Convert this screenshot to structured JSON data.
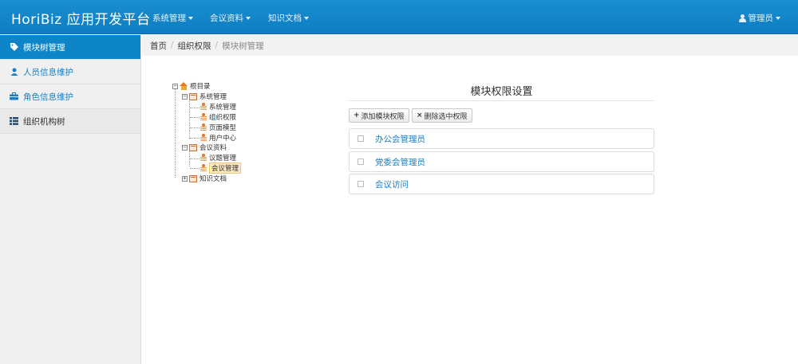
{
  "navbar": {
    "brand": "HoriBiz 应用开发平台",
    "menus": [
      "系统管理",
      "会议资料",
      "知识文档"
    ],
    "user": "管理员"
  },
  "sidebar": {
    "items": [
      {
        "label": "模块树管理",
        "icon": "tag-icon",
        "state": "active"
      },
      {
        "label": "人员信息维护",
        "icon": "user-icon",
        "state": "link"
      },
      {
        "label": "角色信息维护",
        "icon": "briefcase-icon",
        "state": "link"
      },
      {
        "label": "组织机构树",
        "icon": "list-icon",
        "state": "plain"
      }
    ]
  },
  "breadcrumb": {
    "home": "首页",
    "section": "组织权限",
    "current": "模块树管理"
  },
  "tree": {
    "root": "根目录",
    "nodes": [
      {
        "label": "系统管理",
        "children": [
          "系统管理",
          "组织权限",
          "页面模型",
          "用户中心"
        ]
      },
      {
        "label": "会议资料",
        "children": [
          "议题管理",
          "会议管理"
        ],
        "selected": "会议管理"
      },
      {
        "label": "知识文档",
        "children": []
      }
    ]
  },
  "panel": {
    "title": "模块权限设置",
    "add_button": "添加模块权限",
    "delete_button": "删除选中权限",
    "permissions": [
      "办公会管理员",
      "党委会管理员",
      "会议访问"
    ]
  },
  "colors": {
    "navbar": "#0d7dc2",
    "sidebar_active": "#0d85c8",
    "link": "#1a7fc4"
  }
}
